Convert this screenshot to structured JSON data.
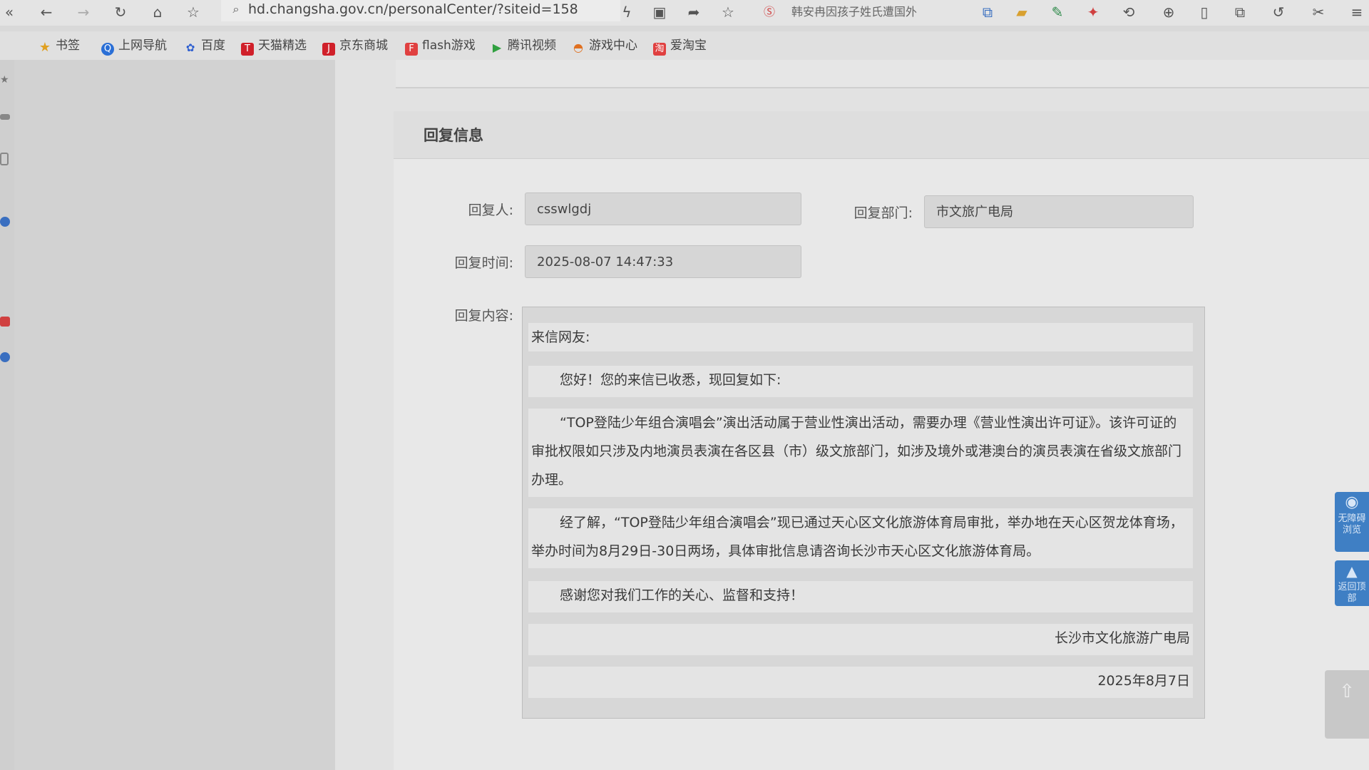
{
  "browser": {
    "url": "hd.changsha.gov.cn/personalCenter/?siteid=158",
    "news_ticker": "韩安冉因孩子姓氏遭国外",
    "bookmarks": [
      {
        "label": "书签",
        "icon": "star-icon",
        "color": "#e0a020"
      },
      {
        "label": "上网导航",
        "icon": "navigation-icon",
        "color": "#2a6fd6"
      },
      {
        "label": "百度",
        "icon": "baidu-icon",
        "color": "#3060d0"
      },
      {
        "label": "天猫精选",
        "icon": "tmall-icon",
        "color": "#d0202a"
      },
      {
        "label": "京东商城",
        "icon": "jd-icon",
        "color": "#d0202a"
      },
      {
        "label": "flash游戏",
        "icon": "flash-game-icon",
        "color": "#e04040"
      },
      {
        "label": "腾讯视频",
        "icon": "tencent-video-icon",
        "color": "#30a040"
      },
      {
        "label": "游戏中心",
        "icon": "game-center-icon",
        "color": "#e07020"
      },
      {
        "label": "爱淘宝",
        "icon": "taobao-icon",
        "color": "#e04040"
      }
    ]
  },
  "reply": {
    "section_title": "回复信息",
    "replier_label": "回复人:",
    "replier_value": "csswlgdj",
    "dept_label": "回复部门:",
    "dept_value": "市文旅广电局",
    "time_label": "回复时间:",
    "time_value": "2025-08-07 14:47:33",
    "content_label": "回复内容:",
    "content": {
      "greeting": "来信网友:",
      "intro": "您好！您的来信已收悉，现回复如下:",
      "para1": "“TOP登陆少年组合演唱会”演出活动属于营业性演出活动，需要办理《营业性演出许可证》。该许可证的审批权限如只涉及内地演员表演在各区县（市）级文旅部门，如涉及境外或港澳台的演员表演在省级文旅部门办理。",
      "para2": "经了解，“TOP登陆少年组合演唱会”现已通过天心区文化旅游体育局审批，举办地在天心区贺龙体育场，举办时间为8月29日-30日两场，具体审批信息请咨询长沙市天心区文化旅游体育局。",
      "thanks": "感谢您对我们工作的关心、监督和支持！",
      "signature": "长沙市文化旅游广电局",
      "date": "2025年8月7日"
    }
  },
  "floating": {
    "eye_label": "无障碍浏览",
    "top_label": "返回顶部"
  }
}
